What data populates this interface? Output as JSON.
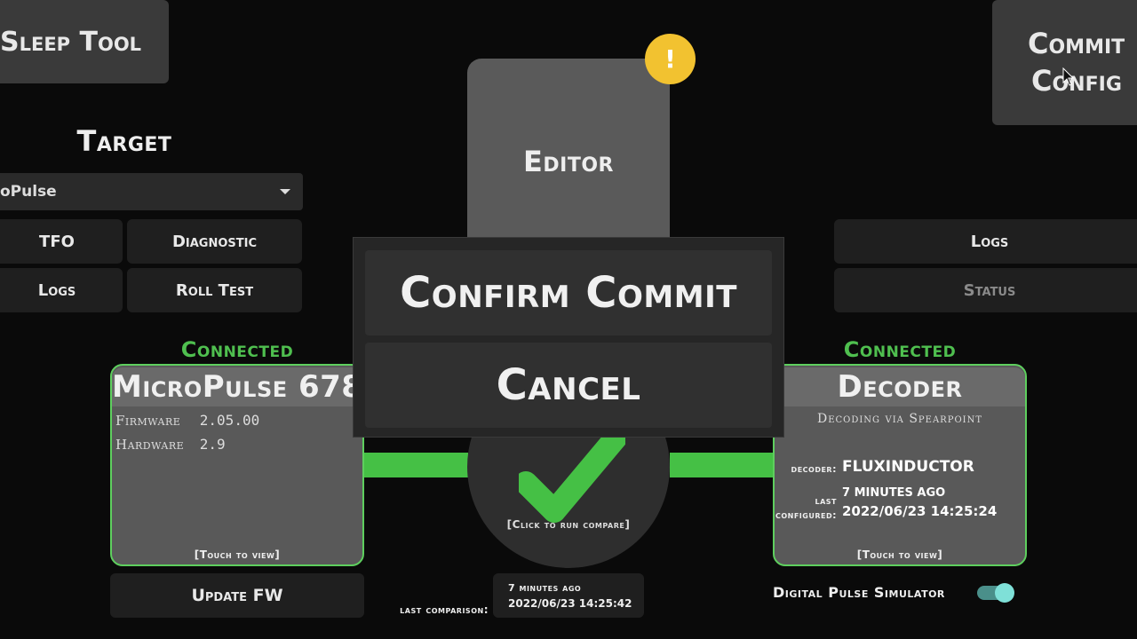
{
  "toolbar": {
    "sleep_tool_label": "Sleep Tool",
    "commit_config_line1": "Commit",
    "commit_config_line2": "Config"
  },
  "target": {
    "heading": "Target",
    "selected": "oPulse",
    "buttons": [
      "TFO",
      "Diagnostic",
      "Logs",
      "Roll Test"
    ]
  },
  "editor": {
    "label": "Editor",
    "warning_glyph": "!"
  },
  "right_buttons": {
    "logs": "Logs",
    "status": "Status"
  },
  "dialog": {
    "confirm_label": "Confirm Commit",
    "cancel_label": "Cancel"
  },
  "left_card": {
    "status": "Connected",
    "title": "MicroPulse 678",
    "firmware_label": "Firmware",
    "firmware_value": "2.05.00",
    "hardware_label": "Hardware",
    "hardware_value": "2.9",
    "touch_hint": "[Touch to view]",
    "update_label": "Update FW"
  },
  "right_card": {
    "status": "Connected",
    "title": "Decoder",
    "subtitle": "Decoding via Spearpoint",
    "decoder_label": "decoder:",
    "decoder_value": "FLUXINDUCTOR",
    "last_label": "last",
    "configured_label": "configured:",
    "ago": "7 MINUTES AGO",
    "datetime": "2022/06/23 14:25:24",
    "touch_hint": "[Touch to view]"
  },
  "compare": {
    "hint": "[Click to run compare]",
    "last_label": "last comparison:",
    "ago": "7 minutes ago",
    "datetime": "2022/06/23 14:25:42"
  },
  "simulator": {
    "label": "Digital Pulse Simulator",
    "enabled": true
  },
  "colors": {
    "accent_green": "#4fbf4f",
    "warning_yellow": "#f2c230",
    "toggle_teal": "#7fe0d8"
  }
}
